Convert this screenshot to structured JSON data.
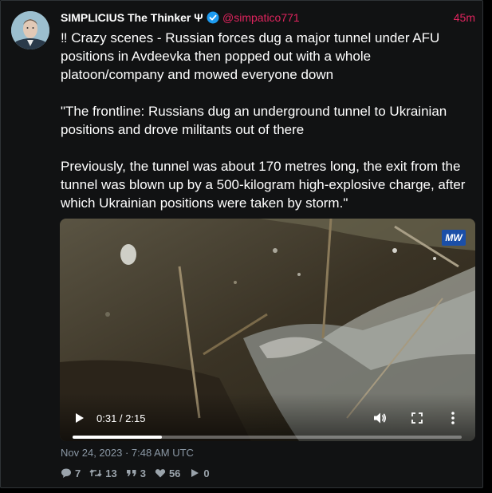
{
  "post": {
    "author_name": "SIMPLICIUS The Thinker Ψ",
    "author_handle": "@simpatico771",
    "time_ago": "45m",
    "paragraphs": [
      "‼ Crazy scenes - Russian forces dug a major tunnel under AFU positions in Avdeevka then popped out with a whole platoon/company and mowed everyone down",
      "\"The frontline: Russians dug an underground tunnel to Ukrainian positions and drove militants out of there",
      "Previously, the tunnel was about 170 metres long, the exit from the tunnel was blown up by a 500-kilogram high-explosive charge, after which Ukrainian positions were taken by storm.\""
    ],
    "date": "Nov 24, 2023 · 7:48 AM UTC"
  },
  "video": {
    "watermark": "MW",
    "current_time": "0:31",
    "duration": "2:15",
    "time_display": "0:31 / 2:15",
    "progress_fraction": 0.23
  },
  "stats": {
    "replies": "7",
    "retweets": "13",
    "quotes": "3",
    "likes": "56",
    "views": "0"
  },
  "colors": {
    "handle": "#e0245e",
    "verified": "#1d9bf0",
    "background": "#111213"
  },
  "icons": [
    "verified-badge-icon",
    "play-icon",
    "volume-icon",
    "fullscreen-icon",
    "more-options-icon",
    "reply-icon",
    "retweet-icon",
    "quote-icon",
    "like-icon",
    "views-icon"
  ]
}
